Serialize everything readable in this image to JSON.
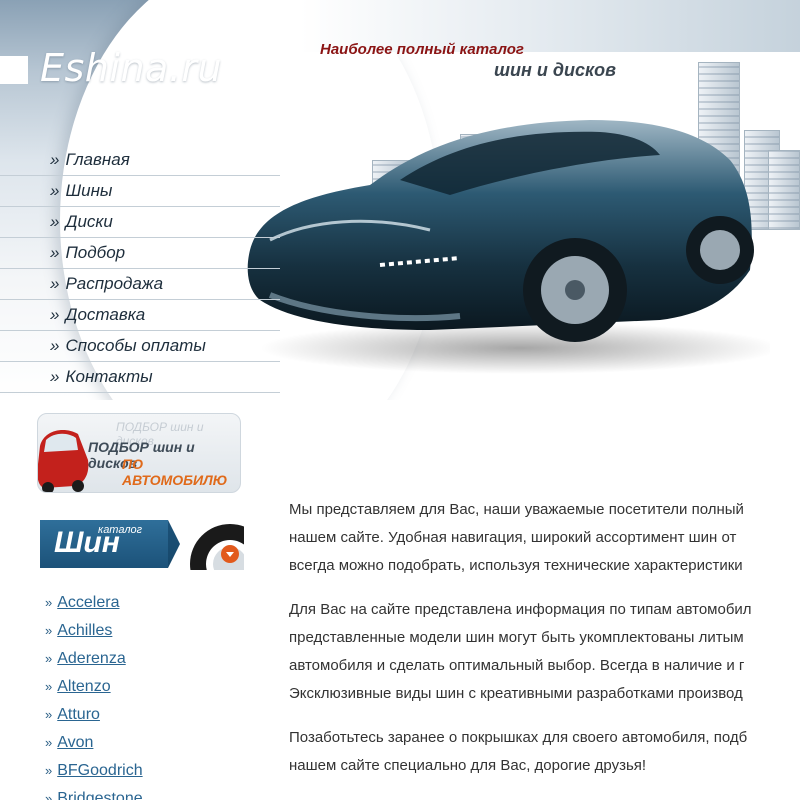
{
  "site": {
    "logo": "Eshina.ru",
    "slogan_line1": "Наиболее полный каталог",
    "slogan_line2": "шин и дисков"
  },
  "nav": {
    "arrow": "»",
    "items": [
      "Главная",
      "Шины",
      "Диски",
      "Подбор",
      "Распродажа",
      "Доставка",
      "Способы оплаты",
      "Контакты"
    ]
  },
  "promo": {
    "ghost_text": "ПОДБОР шин и дисков",
    "line1": "ПОДБОР шин и дисков",
    "line2": "ПО АВТОМОБИЛЮ"
  },
  "tire_catalog": {
    "big": "Шин",
    "small": "каталог"
  },
  "brands": {
    "arrow": "»",
    "items": [
      "Accelera",
      "Achilles",
      "Aderenza",
      "Altenzo",
      "Atturo",
      "Avon",
      "BFGoodrich",
      "Bridgestone"
    ]
  },
  "content": {
    "p1": [
      "Мы представляем для Вас, наши уважаемые посетители полный",
      "нашем сайте. Удобная навигация, широкий ассортимент шин от",
      "всегда можно подобрать, используя технические характеристики"
    ],
    "p2": [
      "Для Вас на сайте представлена информация по типам автомобил",
      "представленные модели шин могут быть укомплектованы литым",
      "автомобиля и сделать оптимальный выбор. Всегда в наличие и г",
      "Эксклюзивные виды шин с креативными разработками производ"
    ],
    "p3": [
      "Позаботьтесь заранее о покрышках для своего автомобиля, подб",
      "нашем сайте специально для Вас, дорогие друзья!"
    ]
  },
  "colors": {
    "slogan_red": "#8b1414",
    "link_blue": "#2a6591",
    "banner_blue": "#1c5279",
    "promo_orange": "#e06a1a"
  }
}
